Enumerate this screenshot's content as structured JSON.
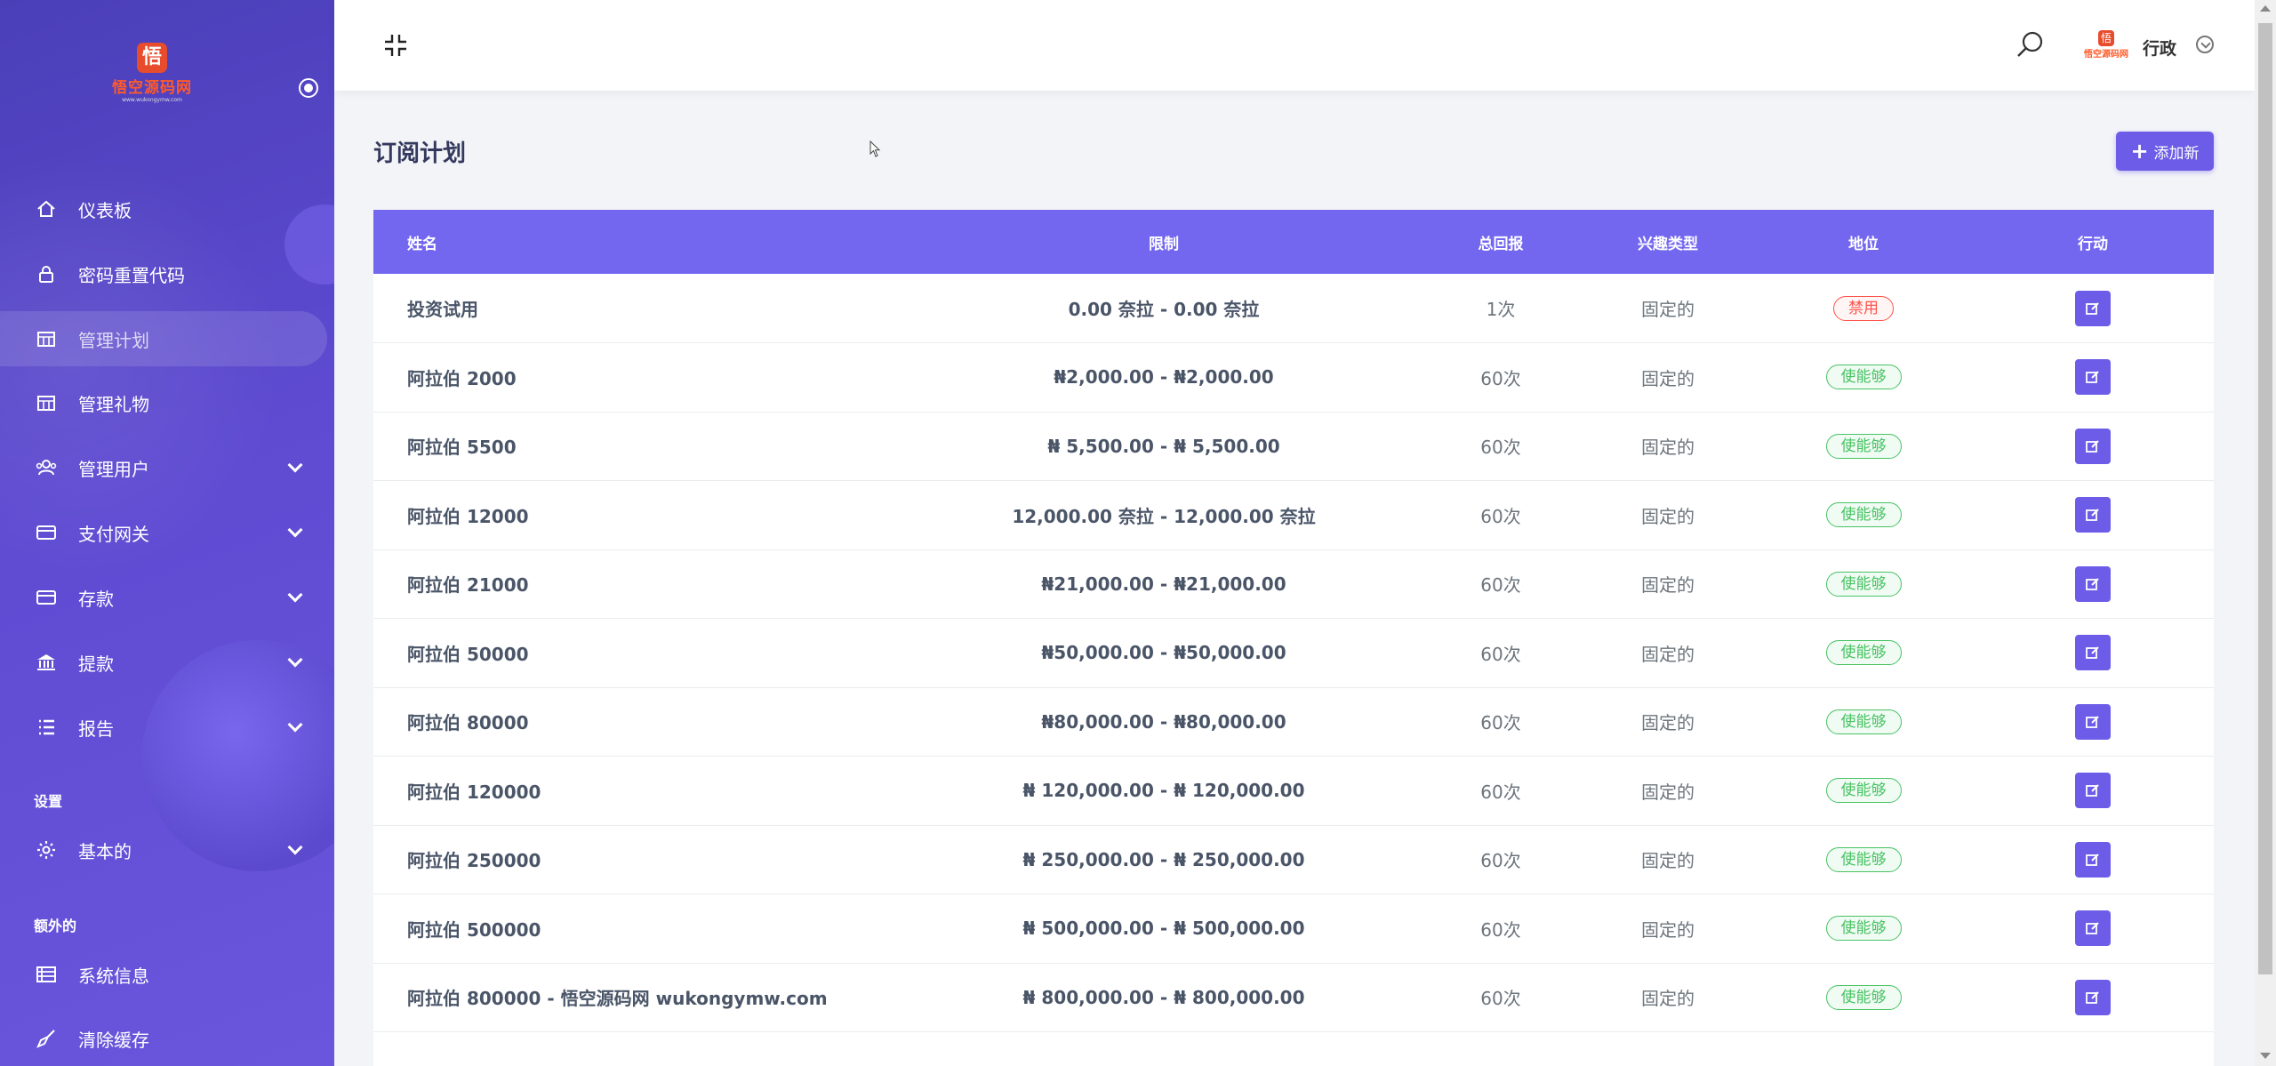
{
  "logo": {
    "glyph": "悟",
    "name": "悟空源码网",
    "sub": "www.wukongymw.com"
  },
  "sidebar": {
    "items": [
      {
        "label": "仪表板",
        "icon": "home-icon",
        "has_children": false,
        "active": false
      },
      {
        "label": "密码重置代码",
        "icon": "lock-icon",
        "has_children": false,
        "active": false
      },
      {
        "label": "管理计划",
        "icon": "building-icon",
        "has_children": false,
        "active": true
      },
      {
        "label": "管理礼物",
        "icon": "building-icon",
        "has_children": false,
        "active": false
      },
      {
        "label": "管理用户",
        "icon": "users-icon",
        "has_children": true,
        "active": false
      },
      {
        "label": "支付网关",
        "icon": "credit-card-icon",
        "has_children": true,
        "active": false
      },
      {
        "label": "存款",
        "icon": "credit-card-icon",
        "has_children": true,
        "active": false
      },
      {
        "label": "提款",
        "icon": "bank-icon",
        "has_children": true,
        "active": false
      },
      {
        "label": "报告",
        "icon": "list-icon",
        "has_children": true,
        "active": false
      }
    ],
    "section_settings": "设置",
    "settings_items": [
      {
        "label": "基本的",
        "icon": "gear-icon",
        "has_children": true
      }
    ],
    "section_extra": "额外的",
    "extra_items": [
      {
        "label": "系统信息",
        "icon": "server-icon"
      },
      {
        "label": "清除缓存",
        "icon": "broom-icon"
      }
    ]
  },
  "header": {
    "user_name": "行政",
    "avatar_glyph": "悟",
    "avatar_word": "悟空源码网"
  },
  "main": {
    "title": "订阅计划",
    "add_button": "添加新",
    "columns": [
      "姓名",
      "限制",
      "总回报",
      "兴趣类型",
      "地位",
      "行动"
    ],
    "rows": [
      {
        "name": "投资试用",
        "limit": "0.00 奈拉 - 0.00 奈拉",
        "return": "1次",
        "type": "固定的",
        "status": "禁用",
        "enabled": false
      },
      {
        "name": "阿拉伯 2000",
        "limit": "₦2,000.00 - ₦2,000.00",
        "return": "60次",
        "type": "固定的",
        "status": "使能够",
        "enabled": true
      },
      {
        "name": "阿拉伯 5500",
        "limit": "₦ 5,500.00 - ₦ 5,500.00",
        "return": "60次",
        "type": "固定的",
        "status": "使能够",
        "enabled": true
      },
      {
        "name": "阿拉伯 12000",
        "limit": "12,000.00 奈拉 - 12,000.00 奈拉",
        "return": "60次",
        "type": "固定的",
        "status": "使能够",
        "enabled": true
      },
      {
        "name": "阿拉伯 21000",
        "limit": "₦21,000.00 - ₦21,000.00",
        "return": "60次",
        "type": "固定的",
        "status": "使能够",
        "enabled": true
      },
      {
        "name": "阿拉伯 50000",
        "limit": "₦50,000.00 - ₦50,000.00",
        "return": "60次",
        "type": "固定的",
        "status": "使能够",
        "enabled": true
      },
      {
        "name": "阿拉伯 80000",
        "limit": "₦80,000.00 - ₦80,000.00",
        "return": "60次",
        "type": "固定的",
        "status": "使能够",
        "enabled": true
      },
      {
        "name": "阿拉伯 120000",
        "limit": "₦ 120,000.00 - ₦ 120,000.00",
        "return": "60次",
        "type": "固定的",
        "status": "使能够",
        "enabled": true
      },
      {
        "name": "阿拉伯 250000",
        "limit": "₦ 250,000.00 - ₦ 250,000.00",
        "return": "60次",
        "type": "固定的",
        "status": "使能够",
        "enabled": true
      },
      {
        "name": "阿拉伯 500000",
        "limit": "₦ 500,000.00 - ₦ 500,000.00",
        "return": "60次",
        "type": "固定的",
        "status": "使能够",
        "enabled": true
      },
      {
        "name": "阿拉伯 800000 - 悟空源码网 wukongymw.com",
        "limit": "₦ 800,000.00 - ₦ 800,000.00",
        "return": "60次",
        "type": "固定的",
        "status": "使能够",
        "enabled": true
      }
    ]
  },
  "colors": {
    "sidebar": "#5e4bd2",
    "accent": "#7367f0",
    "button": "#6c5ce7",
    "danger": "#fc544b",
    "success": "#47c363"
  }
}
